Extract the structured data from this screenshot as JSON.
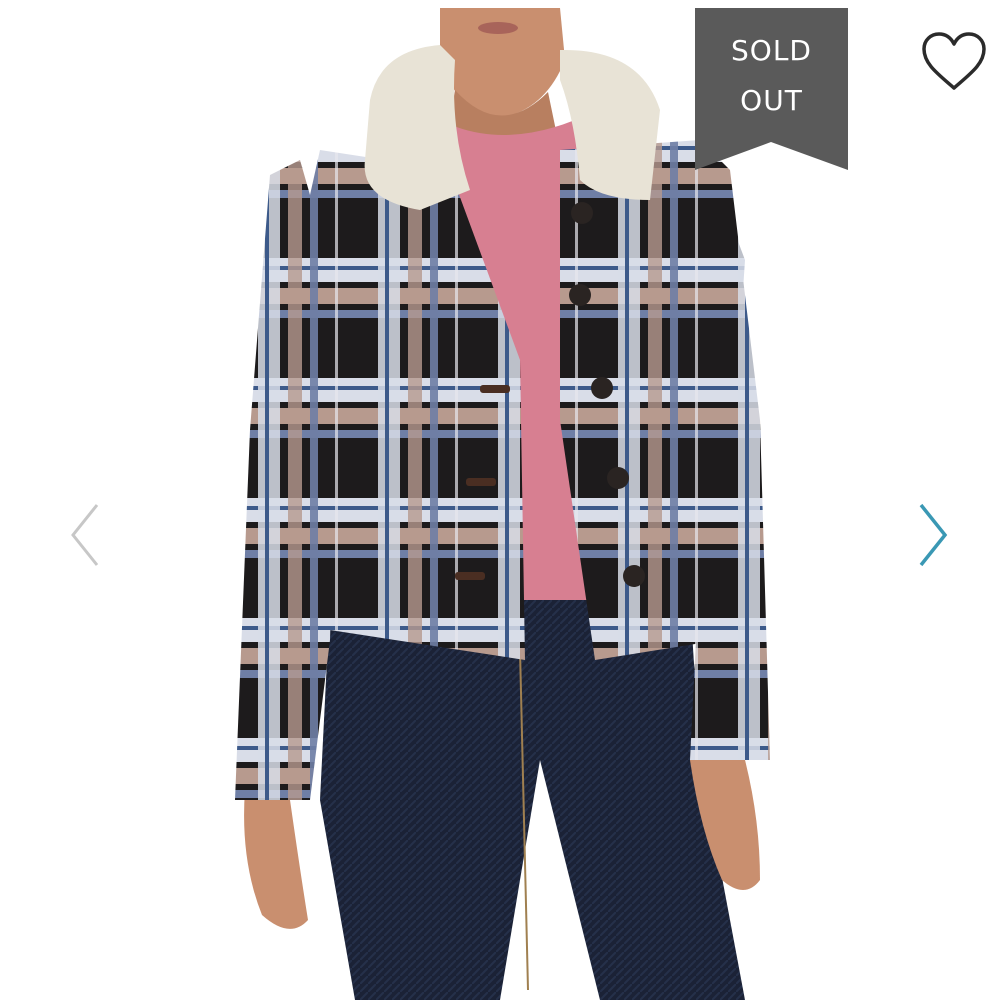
{
  "product": {
    "image_alt": "",
    "badge": {
      "line1": "SOLD",
      "line2": "OUT"
    }
  },
  "controls": {
    "favorite_icon": "heart-outline-icon",
    "prev_icon": "chevron-left-icon",
    "next_icon": "chevron-right-icon"
  },
  "colors": {
    "badge_bg": "#5a5a5a",
    "badge_text": "#ffffff",
    "heart_stroke": "#2b2b2b",
    "next_arrow": "#3a98b4",
    "prev_arrow": "#c7c7c7"
  }
}
